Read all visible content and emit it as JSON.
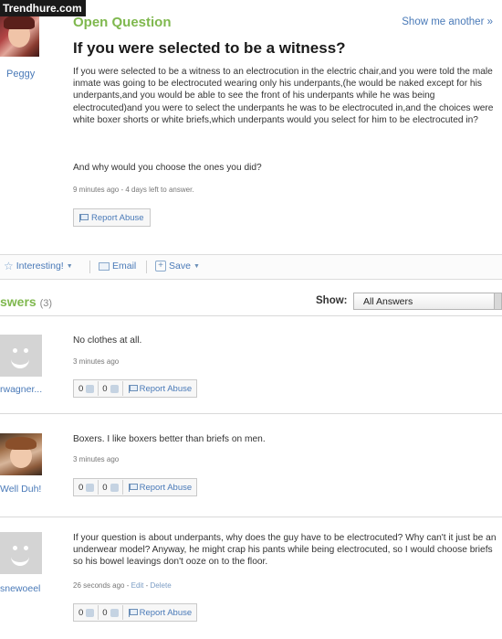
{
  "watermark": "Trendhure.com",
  "question": {
    "label": "Open Question",
    "show_another": "Show me another »",
    "asker_name": "Peggy",
    "title": "If you were selected to be a witness?",
    "body": "If you were selected to be a witness to an electrocution in the electric chair,and you were told the male inmate was going to be electrocuted wearing only his underpants,(he would be naked except for his underpants,and you would be able to see the front of his underpants while he was being electrocuted)and you were to select the underpants he was to be electrocuted in,and the choices were white boxer shorts or white briefs,which underpants would you select for him to be electrocuted in?",
    "why": "And why would you choose the ones you did?",
    "meta": "9 minutes ago - 4 days left to answer.",
    "report_label": "Report Abuse"
  },
  "actions": {
    "interesting": "Interesting!",
    "email": "Email",
    "save": "Save"
  },
  "answers_header": {
    "title": "swers",
    "count": "(3)",
    "show_label": "Show:",
    "show_value": "All Answers"
  },
  "answers": [
    {
      "user": "rwagner...",
      "text": "No clothes at all.",
      "meta": "3 minutes ago",
      "thumbs_up": "0",
      "thumbs_down": "0",
      "report": "Report Abuse"
    },
    {
      "user": "Well Duh!",
      "text": "Boxers. I like boxers better than briefs on men.",
      "meta": "3 minutes ago",
      "thumbs_up": "0",
      "thumbs_down": "0",
      "report": "Report Abuse"
    },
    {
      "user": "snewoeel",
      "text": "If your question is about underpants, why does the guy have to be electrocuted? Why can't it just be an underwear model? Anyway, he might crap his pants while being electrocuted, so I would choose briefs so his bowel leavings don't ooze on to the floor.",
      "meta_time": "26 seconds ago - ",
      "meta_edit": "Edit",
      "meta_sep": " - ",
      "meta_delete": "Delete",
      "thumbs_up": "0",
      "thumbs_down": "0",
      "report": "Report Abuse"
    }
  ]
}
